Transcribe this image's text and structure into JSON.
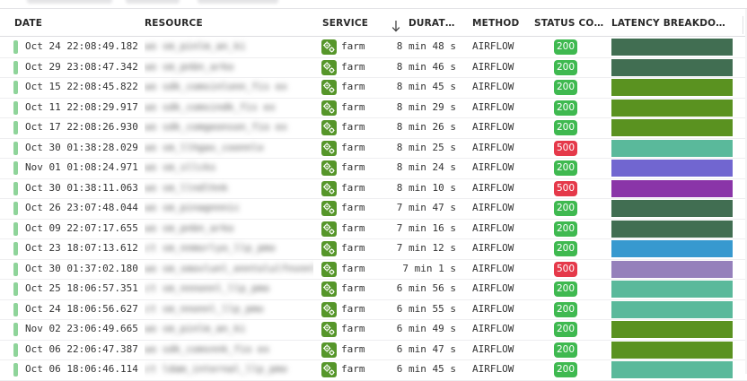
{
  "columns": {
    "date": "DATE",
    "resource": "RESOURCE",
    "service": "SERVICE",
    "duration": "DURATI...",
    "method": "METHOD",
    "status": "STATUS CODE",
    "latency": "LATENCY BREAKDOWN"
  },
  "sort": {
    "column": "duration",
    "direction": "descending",
    "icon": "arrow-down-icon"
  },
  "colors": {
    "ok_badge": "#3fb950",
    "error_badge": "#e5394a",
    "status_bar": "#8fd49a",
    "service_icon": "#56962a"
  },
  "rows": [
    {
      "date": "Oct 24 22:08:49.182",
      "resource": "wo sm_pinlm_an_ki",
      "service": "farm",
      "duration": "8 min 48 s",
      "method": "AIRFLOW",
      "status": "200",
      "latency_color": "#416e52"
    },
    {
      "date": "Oct 29 23:08:47.342",
      "resource": "wo sm_pnbn_arko",
      "service": "farm",
      "duration": "8 min 46 s",
      "method": "AIRFLOW",
      "status": "200",
      "latency_color": "#416e52"
    },
    {
      "date": "Oct 15 22:08:45.822",
      "resource": "wo sdk_comsinlonn_fis ex",
      "service": "farm",
      "duration": "8 min 45 s",
      "method": "AIRFLOW",
      "status": "200",
      "latency_color": "#5a9220"
    },
    {
      "date": "Oct 11 22:08:29.917",
      "resource": "wo sdk_comsindk_fis ex",
      "service": "farm",
      "duration": "8 min 29 s",
      "method": "AIRFLOW",
      "status": "200",
      "latency_color": "#5a9220"
    },
    {
      "date": "Oct 17 22:08:26.930",
      "resource": "wo sdk_comgeonson_fio ex",
      "service": "farm",
      "duration": "8 min 26 s",
      "method": "AIRFLOW",
      "status": "200",
      "latency_color": "#5a9220"
    },
    {
      "date": "Oct 30 01:38:28.029",
      "resource": "wo sm_llhgas_coonnlo",
      "service": "farm",
      "duration": "8 min 25 s",
      "method": "AIRFLOW",
      "status": "500",
      "latency_color": "#5ab99b"
    },
    {
      "date": "Nov 01 01:08:24.971",
      "resource": "wo sm_sllcks",
      "service": "farm",
      "duration": "8 min 24 s",
      "method": "AIRFLOW",
      "status": "200",
      "latency_color": "#7166d0"
    },
    {
      "date": "Oct 30 01:38:11.063",
      "resource": "wo sm_llndlhnk",
      "service": "farm",
      "duration": "8 min 10 s",
      "method": "AIRFLOW",
      "status": "500",
      "latency_color": "#8a35a8"
    },
    {
      "date": "Oct 26 23:07:48.044",
      "resource": "wo sm_pinagnnnic",
      "service": "farm",
      "duration": "7 min 47 s",
      "method": "AIRFLOW",
      "status": "200",
      "latency_color": "#416e52"
    },
    {
      "date": "Oct 09 22:07:17.655",
      "resource": "wo sm_pnbn_arko",
      "service": "farm",
      "duration": "7 min 16 s",
      "method": "AIRFLOW",
      "status": "200",
      "latency_color": "#416e52"
    },
    {
      "date": "Oct 23 18:07:13.612",
      "resource": "ct sm_nnmorlyo_llp_pmo",
      "service": "farm",
      "duration": "7 min 12 s",
      "method": "AIRFLOW",
      "status": "200",
      "latency_color": "#3799cf"
    },
    {
      "date": "Oct 30 01:37:02.180",
      "resource": "wo sm_smovlunl_enntolulfnsnnl wl",
      "service": "farm",
      "duration": "7 min 1 s",
      "method": "AIRFLOW",
      "status": "500",
      "latency_color": "#9580bb"
    },
    {
      "date": "Oct 25 18:06:57.351",
      "resource": "ct sm_nnnonnl_llp_pmo",
      "service": "farm",
      "duration": "6 min 56 s",
      "method": "AIRFLOW",
      "status": "200",
      "latency_color": "#5ab99b"
    },
    {
      "date": "Oct 24 18:06:56.627",
      "resource": "ct sm_nnonnl_llp_pmo",
      "service": "farm",
      "duration": "6 min 55 s",
      "method": "AIRFLOW",
      "status": "200",
      "latency_color": "#5ab99b"
    },
    {
      "date": "Nov 02 23:06:49.665",
      "resource": "wo sm_pinlm_an_ki",
      "service": "farm",
      "duration": "6 min 49 s",
      "method": "AIRFLOW",
      "status": "200",
      "latency_color": "#5a9220"
    },
    {
      "date": "Oct 06 22:06:47.387",
      "resource": "wo sdk_comsnnk_fio ex",
      "service": "farm",
      "duration": "6 min 47 s",
      "method": "AIRFLOW",
      "status": "200",
      "latency_color": "#5a9220"
    },
    {
      "date": "Oct 06 18:06:46.114",
      "resource": "ct ldam_internal_llp_pmo",
      "service": "farm",
      "duration": "6 min 45 s",
      "method": "AIRFLOW",
      "status": "200",
      "latency_color": "#5ab99b"
    }
  ]
}
